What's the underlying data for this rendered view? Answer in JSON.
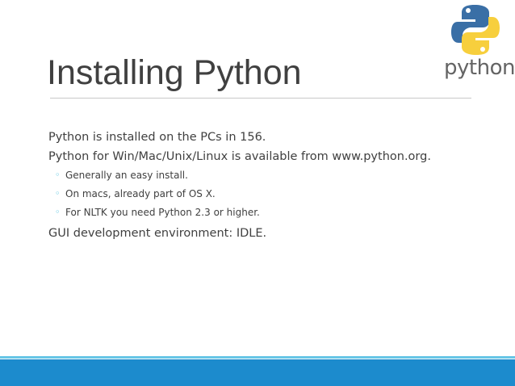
{
  "slide": {
    "title": "Installing Python",
    "logo_text": "python",
    "paragraphs": [
      "Python is installed on the PCs in 156.",
      "Python for Win/Mac/Unix/Linux is available from www.python.org.",
      "GUI development environment: IDLE."
    ],
    "bullets": [
      "Generally an easy install.",
      "On macs, already part of OS X.",
      "For NLTK you need Python 2.3 or higher."
    ]
  },
  "icons": {
    "logo": "python-logo-icon",
    "bullet": "bullet-dot-icon"
  },
  "colors": {
    "title_text": "#404040",
    "body_text": "#404040",
    "bullet_accent": "#3fb9dc",
    "footer_bar": "#1c8bcd",
    "footer_accent": "#67c6e6",
    "logo_blue": "#3a6fa6",
    "logo_yellow": "#f7cf3d"
  }
}
